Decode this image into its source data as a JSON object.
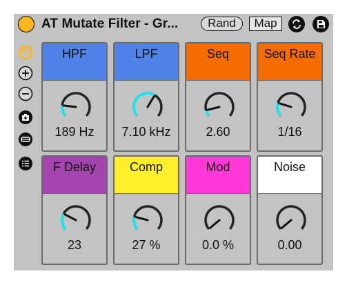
{
  "device": {
    "title": "AT Mutate Filter - Gr...",
    "rand_label": "Rand",
    "map_label": "Map",
    "accent_color": "#ffb71b",
    "knob_arc_color": "#16e5f2"
  },
  "sidebar": {
    "items": [
      {
        "name": "hot-swap-icon"
      },
      {
        "name": "zoom-in-icon"
      },
      {
        "name": "zoom-out-icon"
      },
      {
        "name": "macro-variations-icon"
      },
      {
        "name": "randomize-icon"
      },
      {
        "name": "list-icon"
      }
    ]
  },
  "macros": [
    {
      "label": "HPF",
      "value": "189 Hz",
      "color": "#5182e8",
      "label_color": "#111111",
      "level": 0.18
    },
    {
      "label": "LPF",
      "value": "7.10 kHz",
      "color": "#5182e8",
      "label_color": "#111111",
      "level": 0.62
    },
    {
      "label": "Seq",
      "value": "2.60",
      "color": "#f76c00",
      "label_color": "#111111",
      "level": 0.1
    },
    {
      "label": "Seq Rate",
      "value": "1/16",
      "color": "#f76c00",
      "label_color": "#111111",
      "level": 0.22
    },
    {
      "label": "F Delay",
      "value": "23",
      "color": "#a444ae",
      "label_color": "#111111",
      "level": 0.26
    },
    {
      "label": "Comp",
      "value": "27 %",
      "color": "#ffee2a",
      "label_color": "#111111",
      "level": 0.21
    },
    {
      "label": "Mod",
      "value": "0.0 %",
      "color": "#ff38d6",
      "label_color": "#111111",
      "level": 0.0
    },
    {
      "label": "Noise",
      "value": "0.00",
      "color": "#ffffff",
      "label_color": "#111111",
      "level": 0.0
    }
  ]
}
